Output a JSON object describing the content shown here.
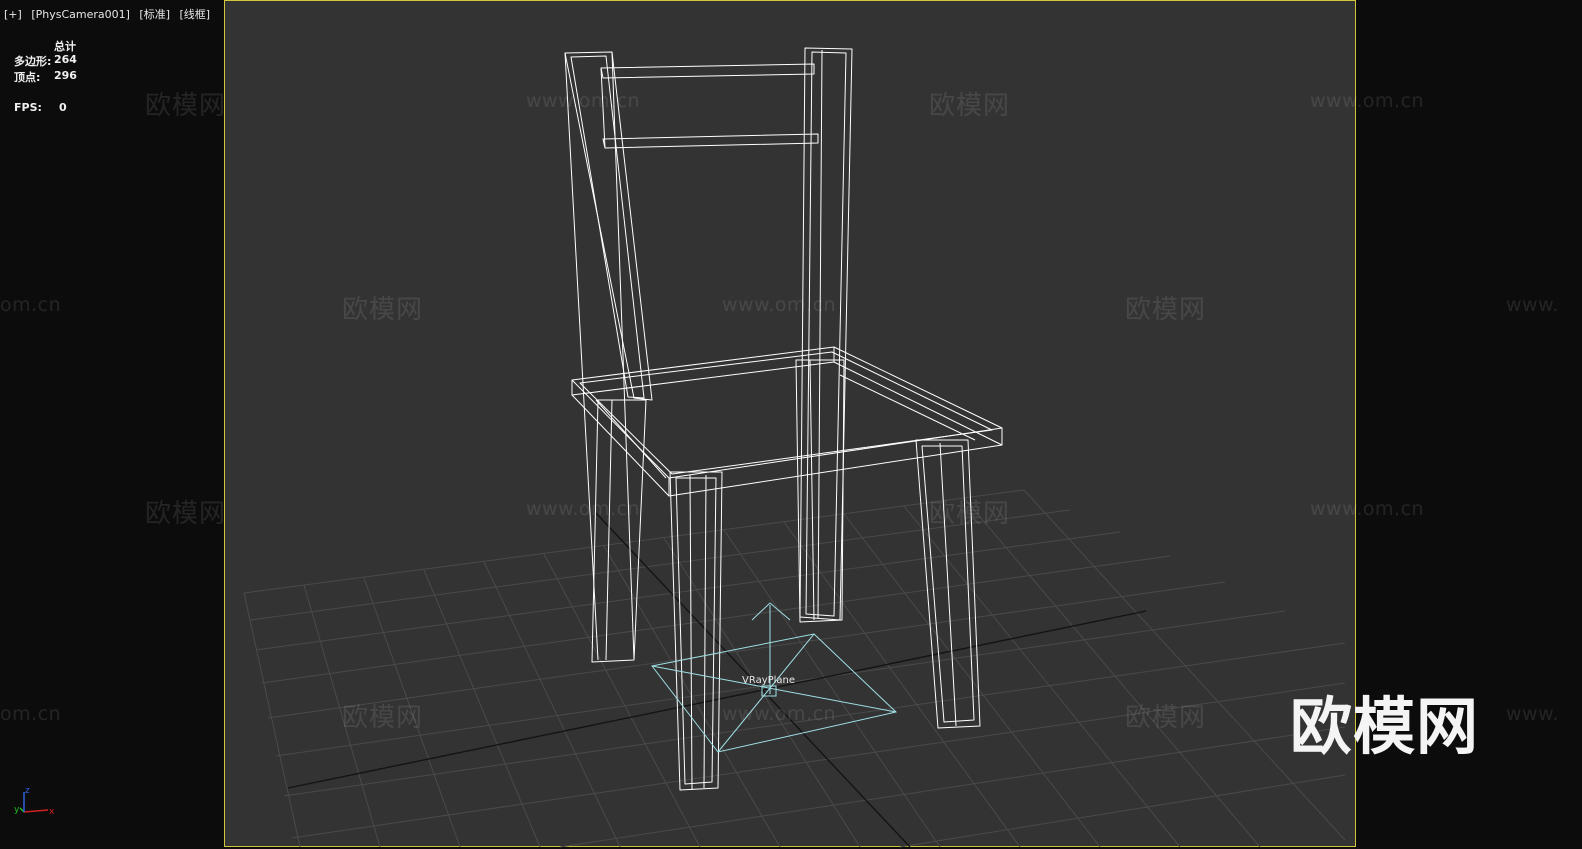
{
  "viewport": {
    "labels": [
      "[+]",
      "[PhysCamera001]",
      "[标准]",
      "[线框]"
    ]
  },
  "stats": {
    "header": "总计",
    "polygons_label": "多边形:",
    "polygons_value": "264",
    "vertices_label": "顶点:",
    "vertices_value": "296",
    "fps_label": "FPS:",
    "fps_value": "0"
  },
  "scene": {
    "object_label": "VRayPlane",
    "wire_color": "#ffffff",
    "helper_color": "#9fe0e6",
    "grid_color": "#4a4a4a",
    "grid_axis_color": "#111111",
    "frame_color": "#d2c63a"
  },
  "axis_gizmo": {
    "x": "x",
    "y": "y",
    "z": "z"
  },
  "watermarks": {
    "brand_text": "欧模网",
    "url_text": "www.om.cn",
    "url_partial_left": "om.cn",
    "url_partial_right": "www."
  },
  "brand_logo": "欧模网"
}
